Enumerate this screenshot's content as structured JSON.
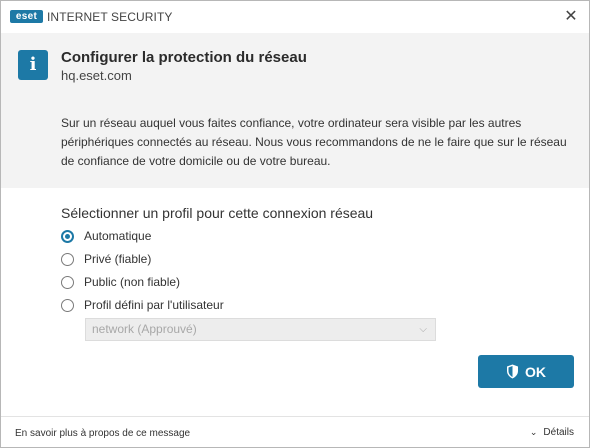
{
  "titlebar": {
    "logo_text": "eset",
    "product_name": "INTERNET SECURITY",
    "close_glyph": "✕"
  },
  "header": {
    "icon_glyph": "i",
    "title": "Configurer la protection du réseau",
    "network_name": "hq.eset.com",
    "description": "Sur un réseau auquel vous faites confiance, votre ordinateur sera visible par les autres périphériques connectés au réseau. Nous vous recommandons de ne le faire que sur le réseau de confiance de votre domicile ou de votre bureau."
  },
  "profile": {
    "prompt": "Sélectionner un profil pour cette connexion réseau",
    "options": [
      {
        "label": "Automatique",
        "checked": true
      },
      {
        "label": "Privé (fiable)",
        "checked": false
      },
      {
        "label": "Public (non fiable)",
        "checked": false
      },
      {
        "label": "Profil défini par l'utilisateur",
        "checked": false
      }
    ],
    "user_profile_select": {
      "value": "network (Approuvé)",
      "enabled": false
    }
  },
  "ok_button": {
    "label": "OK"
  },
  "footer": {
    "learn_more": "En savoir plus à propos de ce message",
    "details": "Détails"
  },
  "colors": {
    "accent": "#1d79a6",
    "header_bg": "#f3f3f3"
  }
}
